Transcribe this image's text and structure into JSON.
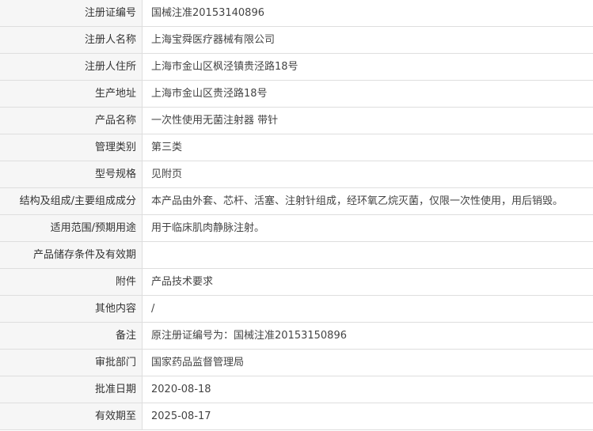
{
  "rows": [
    {
      "label": "注册证编号",
      "value": "国械注准20153140896"
    },
    {
      "label": "注册人名称",
      "value": "上海宝舜医疗器械有限公司"
    },
    {
      "label": "注册人住所",
      "value": "上海市金山区枫泾镇贵泾路18号"
    },
    {
      "label": "生产地址",
      "value": "上海市金山区贵泾路18号"
    },
    {
      "label": "产品名称",
      "value": "一次性使用无菌注射器 带针"
    },
    {
      "label": "管理类别",
      "value": "第三类"
    },
    {
      "label": "型号规格",
      "value": "见附页"
    },
    {
      "label": "结构及组成/主要组成成分",
      "value": "本产品由外套、芯杆、活塞、注射针组成，经环氧乙烷灭菌，仅限一次性使用，用后销毁。"
    },
    {
      "label": "适用范围/预期用途",
      "value": "用于临床肌肉静脉注射。"
    },
    {
      "label": "产品储存条件及有效期",
      "value": ""
    },
    {
      "label": "附件",
      "value": "产品技术要求"
    },
    {
      "label": "其他内容",
      "value": "/"
    },
    {
      "label": "备注",
      "value": "原注册证编号为：国械注准20153150896"
    },
    {
      "label": "审批部门",
      "value": "国家药品监督管理局"
    },
    {
      "label": "批准日期",
      "value": "2020-08-18"
    },
    {
      "label": "有效期至",
      "value": "2025-08-17"
    }
  ]
}
